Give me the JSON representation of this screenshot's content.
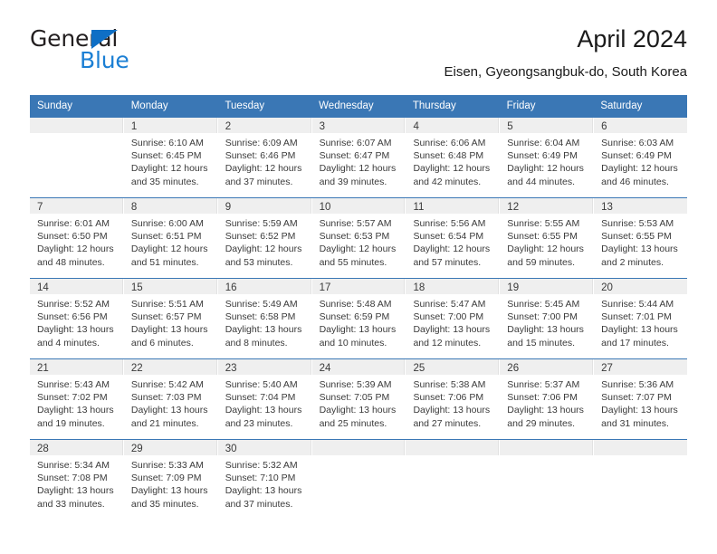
{
  "brand": {
    "name_top": "General",
    "name_bottom": "Blue",
    "triangle_icon": "triangle-icon",
    "accent_blue": "#1b7fd4",
    "dark": "#231f20"
  },
  "header": {
    "title": "April 2024",
    "subtitle": "Eisen, Gyeongsangbuk-do, South Korea"
  },
  "colors": {
    "header_blue": "#3a77b5",
    "daynum_band": "#efefef",
    "text": "#3a3a3a"
  },
  "calendar": {
    "weekdays": [
      "Sunday",
      "Monday",
      "Tuesday",
      "Wednesday",
      "Thursday",
      "Friday",
      "Saturday"
    ],
    "weeks": [
      [
        {
          "day": "",
          "lines": []
        },
        {
          "day": "1",
          "lines": [
            "Sunrise: 6:10 AM",
            "Sunset: 6:45 PM",
            "Daylight: 12 hours",
            "and 35 minutes."
          ]
        },
        {
          "day": "2",
          "lines": [
            "Sunrise: 6:09 AM",
            "Sunset: 6:46 PM",
            "Daylight: 12 hours",
            "and 37 minutes."
          ]
        },
        {
          "day": "3",
          "lines": [
            "Sunrise: 6:07 AM",
            "Sunset: 6:47 PM",
            "Daylight: 12 hours",
            "and 39 minutes."
          ]
        },
        {
          "day": "4",
          "lines": [
            "Sunrise: 6:06 AM",
            "Sunset: 6:48 PM",
            "Daylight: 12 hours",
            "and 42 minutes."
          ]
        },
        {
          "day": "5",
          "lines": [
            "Sunrise: 6:04 AM",
            "Sunset: 6:49 PM",
            "Daylight: 12 hours",
            "and 44 minutes."
          ]
        },
        {
          "day": "6",
          "lines": [
            "Sunrise: 6:03 AM",
            "Sunset: 6:49 PM",
            "Daylight: 12 hours",
            "and 46 minutes."
          ]
        }
      ],
      [
        {
          "day": "7",
          "lines": [
            "Sunrise: 6:01 AM",
            "Sunset: 6:50 PM",
            "Daylight: 12 hours",
            "and 48 minutes."
          ]
        },
        {
          "day": "8",
          "lines": [
            "Sunrise: 6:00 AM",
            "Sunset: 6:51 PM",
            "Daylight: 12 hours",
            "and 51 minutes."
          ]
        },
        {
          "day": "9",
          "lines": [
            "Sunrise: 5:59 AM",
            "Sunset: 6:52 PM",
            "Daylight: 12 hours",
            "and 53 minutes."
          ]
        },
        {
          "day": "10",
          "lines": [
            "Sunrise: 5:57 AM",
            "Sunset: 6:53 PM",
            "Daylight: 12 hours",
            "and 55 minutes."
          ]
        },
        {
          "day": "11",
          "lines": [
            "Sunrise: 5:56 AM",
            "Sunset: 6:54 PM",
            "Daylight: 12 hours",
            "and 57 minutes."
          ]
        },
        {
          "day": "12",
          "lines": [
            "Sunrise: 5:55 AM",
            "Sunset: 6:55 PM",
            "Daylight: 12 hours",
            "and 59 minutes."
          ]
        },
        {
          "day": "13",
          "lines": [
            "Sunrise: 5:53 AM",
            "Sunset: 6:55 PM",
            "Daylight: 13 hours",
            "and 2 minutes."
          ]
        }
      ],
      [
        {
          "day": "14",
          "lines": [
            "Sunrise: 5:52 AM",
            "Sunset: 6:56 PM",
            "Daylight: 13 hours",
            "and 4 minutes."
          ]
        },
        {
          "day": "15",
          "lines": [
            "Sunrise: 5:51 AM",
            "Sunset: 6:57 PM",
            "Daylight: 13 hours",
            "and 6 minutes."
          ]
        },
        {
          "day": "16",
          "lines": [
            "Sunrise: 5:49 AM",
            "Sunset: 6:58 PM",
            "Daylight: 13 hours",
            "and 8 minutes."
          ]
        },
        {
          "day": "17",
          "lines": [
            "Sunrise: 5:48 AM",
            "Sunset: 6:59 PM",
            "Daylight: 13 hours",
            "and 10 minutes."
          ]
        },
        {
          "day": "18",
          "lines": [
            "Sunrise: 5:47 AM",
            "Sunset: 7:00 PM",
            "Daylight: 13 hours",
            "and 12 minutes."
          ]
        },
        {
          "day": "19",
          "lines": [
            "Sunrise: 5:45 AM",
            "Sunset: 7:00 PM",
            "Daylight: 13 hours",
            "and 15 minutes."
          ]
        },
        {
          "day": "20",
          "lines": [
            "Sunrise: 5:44 AM",
            "Sunset: 7:01 PM",
            "Daylight: 13 hours",
            "and 17 minutes."
          ]
        }
      ],
      [
        {
          "day": "21",
          "lines": [
            "Sunrise: 5:43 AM",
            "Sunset: 7:02 PM",
            "Daylight: 13 hours",
            "and 19 minutes."
          ]
        },
        {
          "day": "22",
          "lines": [
            "Sunrise: 5:42 AM",
            "Sunset: 7:03 PM",
            "Daylight: 13 hours",
            "and 21 minutes."
          ]
        },
        {
          "day": "23",
          "lines": [
            "Sunrise: 5:40 AM",
            "Sunset: 7:04 PM",
            "Daylight: 13 hours",
            "and 23 minutes."
          ]
        },
        {
          "day": "24",
          "lines": [
            "Sunrise: 5:39 AM",
            "Sunset: 7:05 PM",
            "Daylight: 13 hours",
            "and 25 minutes."
          ]
        },
        {
          "day": "25",
          "lines": [
            "Sunrise: 5:38 AM",
            "Sunset: 7:06 PM",
            "Daylight: 13 hours",
            "and 27 minutes."
          ]
        },
        {
          "day": "26",
          "lines": [
            "Sunrise: 5:37 AM",
            "Sunset: 7:06 PM",
            "Daylight: 13 hours",
            "and 29 minutes."
          ]
        },
        {
          "day": "27",
          "lines": [
            "Sunrise: 5:36 AM",
            "Sunset: 7:07 PM",
            "Daylight: 13 hours",
            "and 31 minutes."
          ]
        }
      ],
      [
        {
          "day": "28",
          "lines": [
            "Sunrise: 5:34 AM",
            "Sunset: 7:08 PM",
            "Daylight: 13 hours",
            "and 33 minutes."
          ]
        },
        {
          "day": "29",
          "lines": [
            "Sunrise: 5:33 AM",
            "Sunset: 7:09 PM",
            "Daylight: 13 hours",
            "and 35 minutes."
          ]
        },
        {
          "day": "30",
          "lines": [
            "Sunrise: 5:32 AM",
            "Sunset: 7:10 PM",
            "Daylight: 13 hours",
            "and 37 minutes."
          ]
        },
        {
          "day": "",
          "lines": []
        },
        {
          "day": "",
          "lines": []
        },
        {
          "day": "",
          "lines": []
        },
        {
          "day": "",
          "lines": []
        }
      ]
    ]
  }
}
